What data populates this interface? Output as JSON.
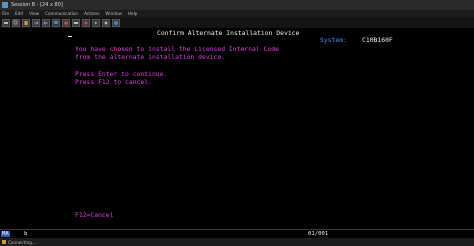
{
  "window": {
    "title": "Session B - [24 x 80]"
  },
  "menubar": {
    "items": [
      "File",
      "Edit",
      "View",
      "Communication",
      "Actions",
      "Window",
      "Help"
    ]
  },
  "toolbar": {
    "buttons": [
      "print-icon",
      "copy-icon",
      "paste-icon",
      "send-icon",
      "receive-icon",
      "display-icon",
      "color-icon",
      "keyboard-icon",
      "record-icon",
      "play-icon",
      "stop-icon",
      "help-icon"
    ]
  },
  "screen": {
    "title": "Confirm Alternate Installation Device",
    "system_label": "System:",
    "system_value": "C10B160F",
    "message_line1": "You have chosen to install the Licensed Internal Code",
    "message_line2": "from the alternate installation device.",
    "enter_line": "Press Enter to continue.",
    "cancel_line": "Press F12 to cancel.",
    "function_key": "F12=Cancel"
  },
  "oia": {
    "indicator": "MA",
    "session": "b",
    "cursor_position": "01/001"
  },
  "status": {
    "text": "Connecting..."
  },
  "colors": {
    "screen_bg": "#000000",
    "white": "#f2f2f2",
    "blue": "#3d8fff",
    "magenta": "#e13de1"
  }
}
